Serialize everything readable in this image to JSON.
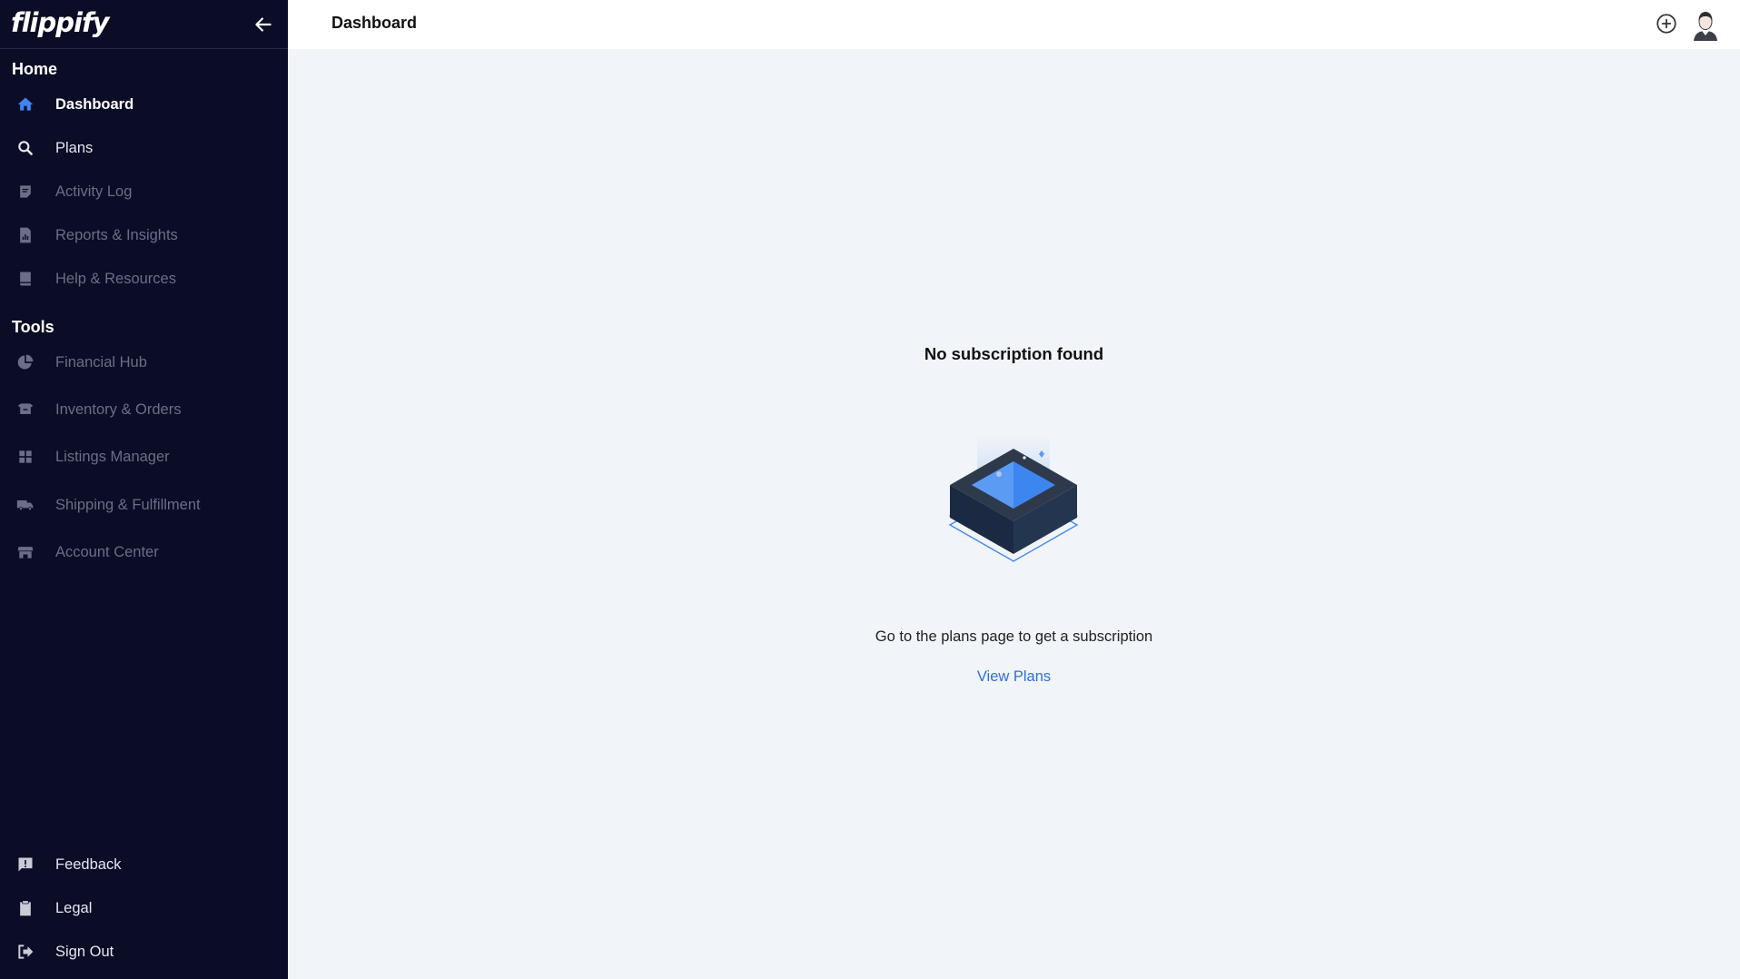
{
  "brand": {
    "logo_text": "flippify"
  },
  "sidebar": {
    "home_section": "Home",
    "tools_section": "Tools",
    "home_items": [
      {
        "label": "Dashboard",
        "icon": "home-icon",
        "state": "active"
      },
      {
        "label": "Plans",
        "icon": "search-icon",
        "state": "normal"
      },
      {
        "label": "Activity Log",
        "icon": "note-icon",
        "state": "disabled"
      },
      {
        "label": "Reports & Insights",
        "icon": "report-icon",
        "state": "disabled"
      },
      {
        "label": "Help & Resources",
        "icon": "book-icon",
        "state": "disabled"
      }
    ],
    "tool_items": [
      {
        "label": "Financial Hub",
        "icon": "pie-chart-icon",
        "state": "disabled"
      },
      {
        "label": "Inventory & Orders",
        "icon": "box-icon",
        "state": "disabled"
      },
      {
        "label": "Listings Manager",
        "icon": "grid-icon",
        "state": "disabled"
      },
      {
        "label": "Shipping & Fulfillment",
        "icon": "truck-icon",
        "state": "disabled"
      },
      {
        "label": "Account Center",
        "icon": "store-icon",
        "state": "disabled"
      }
    ],
    "bottom_items": [
      {
        "label": "Feedback",
        "icon": "feedback-icon",
        "state": "normal"
      },
      {
        "label": "Legal",
        "icon": "clipboard-icon",
        "state": "normal"
      },
      {
        "label": "Sign Out",
        "icon": "sign-out-icon",
        "state": "normal"
      }
    ]
  },
  "header": {
    "title": "Dashboard"
  },
  "main": {
    "empty_title": "No subscription found",
    "empty_message": "Go to the plans page to get a subscription",
    "view_plans_label": "View Plans"
  },
  "colors": {
    "sidebar_bg": "#0b0c25",
    "accent": "#2f6fdc",
    "page_bg": "#f1f4f9"
  }
}
